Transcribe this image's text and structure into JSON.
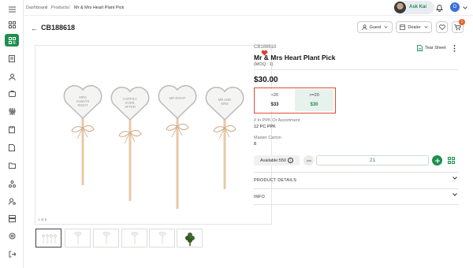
{
  "breadcrumb": {
    "items": [
      "Dashboard",
      "Products",
      "Mr & Mrs Heart Plant Pick"
    ],
    "sep": "/"
  },
  "user": {
    "name": "Ask Kai",
    "avatar_initial": "D"
  },
  "header": {
    "back": "←",
    "sku": "CB188618",
    "guest_label": "Guest",
    "dealer_label": "Dealer",
    "cart_badge": "1"
  },
  "gallery": {
    "counter": "1 of 6",
    "thumb_count": 6
  },
  "product": {
    "sku": "CB188618",
    "title": "Mr & Mrs Heart Plant Pick",
    "moq": "(MOQ : 1)",
    "price": "$30.00",
    "tear_sheet": "Tear Sheet",
    "tiers": [
      {
        "qty": "<20",
        "price": "$33"
      },
      {
        "qty": ">=20",
        "price": "$30"
      }
    ],
    "ppk_label": "# In PPK Or Assortment",
    "ppk_value": "12 PC PPK",
    "carton_label": "Master Carton",
    "carton_value": "8",
    "available": "Available:550",
    "quantity": "21"
  },
  "picks": [
    "MRS ALWAYS RIGHT",
    "HAPPILY EVER AFTER",
    "MR RIGHT",
    "MR AND MRS"
  ],
  "accordions": [
    "PRODUCT DETAILS",
    "INFO"
  ],
  "colors": {
    "accent": "#1f8f4e",
    "highlight": "#e04b3a",
    "cart_badge": "#e8602c"
  }
}
